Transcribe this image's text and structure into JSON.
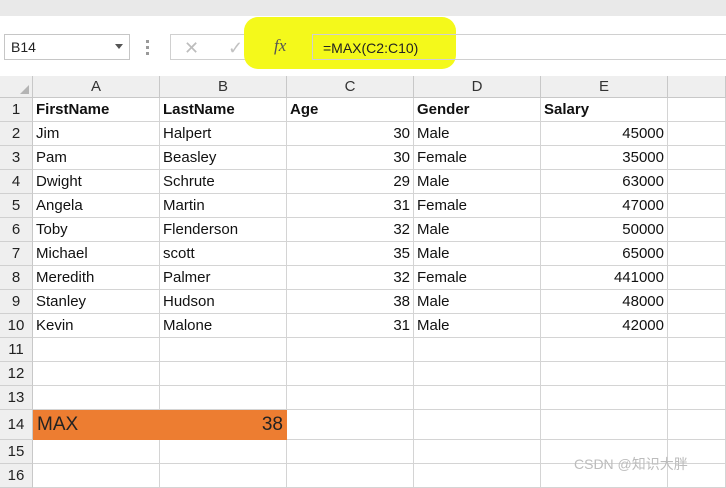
{
  "formula_bar": {
    "name_box": "B14",
    "cancel_icon": "✕",
    "enter_icon": "✓",
    "fx_label": "fx",
    "formula": "=MAX(C2:C10)",
    "highlight_color": "#f4f91b"
  },
  "sheet": {
    "columns": [
      "A",
      "B",
      "C",
      "D",
      "E"
    ],
    "row_numbers": [
      "1",
      "2",
      "3",
      "4",
      "5",
      "6",
      "7",
      "8",
      "9",
      "10",
      "11",
      "12",
      "13",
      "14",
      "15",
      "16"
    ],
    "header": [
      "FirstName",
      "LastName",
      "Age",
      "Gender",
      "Salary"
    ],
    "rows": [
      [
        "Jim",
        "Halpert",
        "30",
        "Male",
        "45000"
      ],
      [
        "Pam",
        "Beasley",
        "30",
        "Female",
        "35000"
      ],
      [
        "Dwight",
        "Schrute",
        "29",
        "Male",
        "63000"
      ],
      [
        "Angela",
        "Martin",
        "31",
        "Female",
        "47000"
      ],
      [
        "Toby",
        "Flenderson",
        "32",
        "Male",
        "50000"
      ],
      [
        "Michael",
        "scott",
        "35",
        "Male",
        "65000"
      ],
      [
        "Meredith",
        "Palmer",
        "32",
        "Female",
        "441000"
      ],
      [
        "Stanley",
        "Hudson",
        "38",
        "Male",
        "48000"
      ],
      [
        "Kevin",
        "Malone",
        "31",
        "Male",
        "42000"
      ]
    ],
    "result": {
      "label": "MAX",
      "value": "38",
      "fill_color": "#ed7d31"
    }
  },
  "watermark": "CSDN @知识大胖"
}
